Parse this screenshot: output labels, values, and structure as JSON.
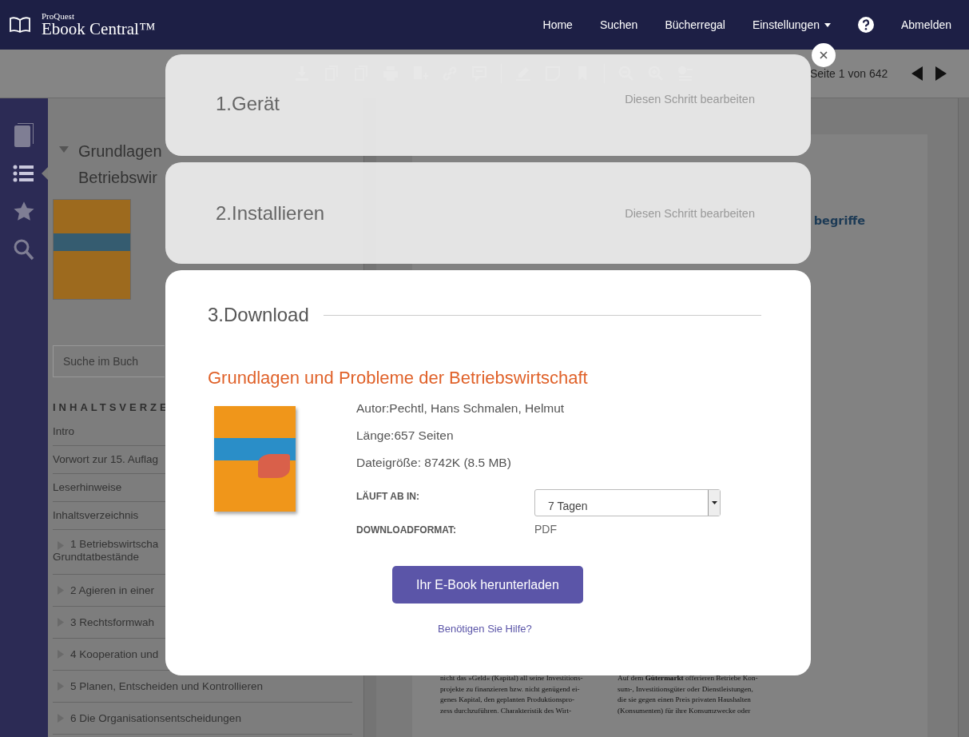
{
  "nav": {
    "brand_small": "ProQuest",
    "brand": "Ebook Central™",
    "links": [
      {
        "label": "Home"
      },
      {
        "label": "Suchen"
      },
      {
        "label": "Bücherregal"
      }
    ],
    "settings": "Einstellungen",
    "logout": "Abmelden"
  },
  "toolbar": {
    "page_indicator": "Seite 1 von 642"
  },
  "sidebar": {
    "items": [
      {
        "kind": "book",
        "selected": false
      },
      {
        "kind": "list",
        "selected": true
      },
      {
        "kind": "star",
        "selected": false
      },
      {
        "kind": "search",
        "selected": false
      }
    ]
  },
  "book_panel": {
    "title_lines": [
      "Grundlagen",
      "Betriebswir"
    ],
    "search": {
      "placeholder": "Suche im Buch"
    },
    "toc_heading": "INHALTSVERZE",
    "toc": [
      {
        "label": "Intro",
        "expandable": false
      },
      {
        "label": "Vorwort zur 15. Auflag",
        "expandable": false
      },
      {
        "label": "Leserhinweise",
        "expandable": false
      },
      {
        "label": "Inhaltsverzeichnis",
        "expandable": false
      },
      {
        "label": "1 Betriebswirtscha",
        "continuation": "Grundtatbestände",
        "expandable": true
      },
      {
        "label": "2 Agieren in einer",
        "expandable": true
      },
      {
        "label": "3 Rechtsformwah",
        "expandable": true
      },
      {
        "label": "4 Kooperation und",
        "expandable": true
      },
      {
        "label": "5 Planen, Entscheiden und Kontrollieren",
        "expandable": true
      },
      {
        "label": "6 Die Organisationsentscheidungen",
        "expandable": true
      }
    ]
  },
  "document": {
    "heading_fragment": "begriffe",
    "columns": [
      [
        "nicht das »Geld« (Kapital) all seine Investitions-",
        "projekte zu finanzieren bzw. nicht genügend ei-",
        "genes Kapital, den geplanten Produktionspro-",
        "zess durchzuführen. Charakteristik des Wirt-"
      ],
      [
        "Auf dem **Gütermarkt** offerieren Betriebe Kon-",
        "sum-, Investitionsgüter oder Dienstleistungen,",
        "die sie gegen einen Preis privaten Haushalten",
        "(Konsumenten) für ihre Konsumzwecke oder"
      ]
    ]
  },
  "modal": {
    "steps": [
      {
        "title": "1.Gerät",
        "edit_link": "Diesen Schritt bearbeiten",
        "expanded": false
      },
      {
        "title": "2.Installieren",
        "edit_link": "Diesen Schritt bearbeiten",
        "expanded": false
      },
      {
        "title": "3.Download",
        "expanded": true
      }
    ],
    "download": {
      "book_title": "Grundlagen und Probleme der Betriebswirtschaft",
      "details": [
        "Autor:Pechtl, Hans Schmalen, Helmut",
        "Länge:657 Seiten",
        "Dateigröße: 8742K (8.5 MB)"
      ],
      "fields": [
        {
          "label": "LÄUFT AB IN:",
          "kind": "select",
          "value": "7 Tagen"
        },
        {
          "label": "DOWNLOADFORMAT:",
          "kind": "text",
          "value": "PDF"
        }
      ],
      "button": "Ihr E-Book herunterladen",
      "help_link": "Benötigen Sie Hilfe?"
    }
  }
}
